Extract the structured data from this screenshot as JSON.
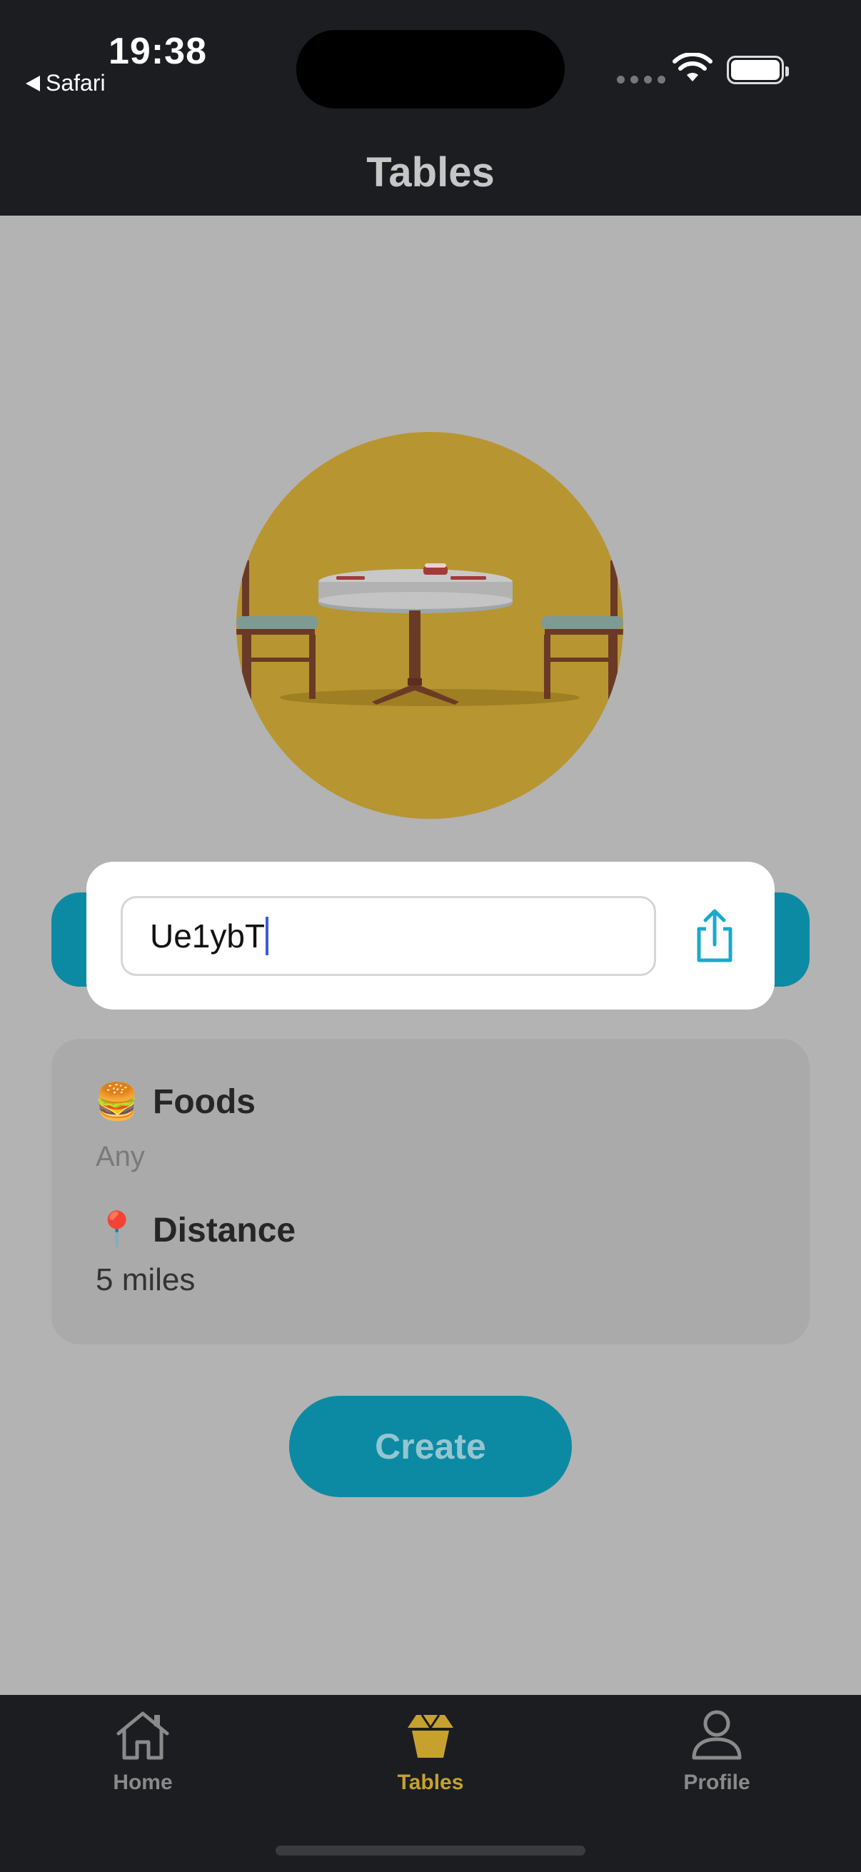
{
  "status_bar": {
    "time": "19:38",
    "back_app": "Safari",
    "back_icon": "triangle-left-icon",
    "signal_icon": "signal-dots-icon",
    "wifi_icon": "wifi-icon",
    "battery_icon": "battery-icon",
    "battery_level": 1.0
  },
  "header": {
    "title": "Tables"
  },
  "hero": {
    "icon": "restaurant-table-illustration"
  },
  "share_sheet": {
    "code_value": "Ue1ybT",
    "share_icon": "share-icon"
  },
  "preferences": {
    "foods": {
      "emoji": "🍔",
      "title": "Foods",
      "value": "Any"
    },
    "distance": {
      "emoji": "📍",
      "title": "Distance",
      "value": "5 miles"
    }
  },
  "actions": {
    "create_label": "Create"
  },
  "tab_bar": {
    "active_tab": "Tables",
    "tabs": [
      {
        "label": "Home",
        "icon": "home-icon"
      },
      {
        "label": "Tables",
        "icon": "takeout-box-icon"
      },
      {
        "label": "Profile",
        "icon": "person-icon"
      }
    ]
  },
  "colors": {
    "bar_background": "#1b1d20",
    "page_background": "#b3b3b3",
    "accent_teal": "#0d8aa3",
    "accent_gold": "#c6a12e",
    "hero_gold": "#b79531",
    "tab_inactive": "#8a8a8a"
  }
}
